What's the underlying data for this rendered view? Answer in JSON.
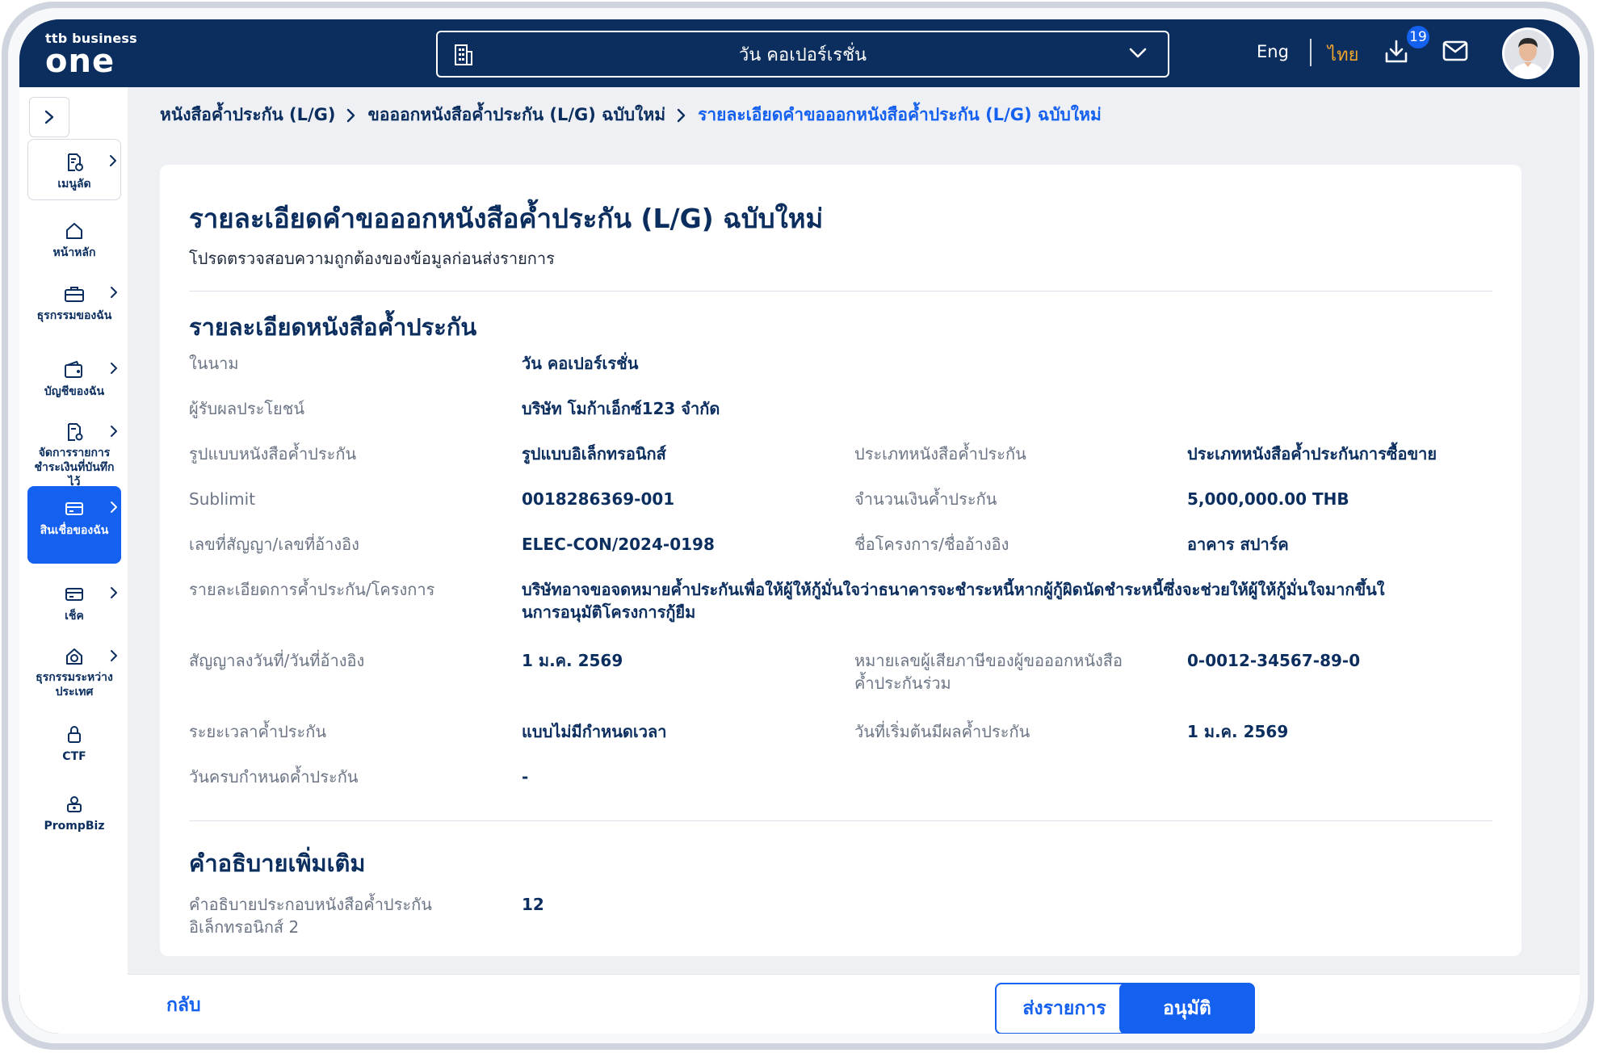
{
  "header": {
    "logo_small": "ttb business",
    "logo_big": "one",
    "company_selected": "วัน คอเปอร์เรชั่น",
    "lang_eng": "Eng",
    "lang_thai": "ไทย",
    "download_badge": "19",
    "accent_color": "#f0a52c",
    "brand_color": "#0b2e5f",
    "primary_color": "#1460ef"
  },
  "sidebar": {
    "items": [
      {
        "label": "เมนูลัด",
        "icon": "document-shortcut-icon"
      },
      {
        "label": "หน้าหลัก",
        "icon": "home-icon"
      },
      {
        "label": "ธุรกรรมของฉัน",
        "icon": "briefcase-icon"
      },
      {
        "label": "บัญชีของฉัน",
        "icon": "wallet-icon"
      },
      {
        "label": "จัดการรายการชำระเงินที่บันทึกไว้",
        "icon": "document-settings-icon"
      },
      {
        "label": "สินเชื่อของฉัน",
        "icon": "credit-card-icon"
      },
      {
        "label": "เช็ค",
        "icon": "cheque-icon"
      },
      {
        "label": "ธุรกรรมระหว่างประเทศ",
        "icon": "international-icon"
      },
      {
        "label": "CTF",
        "icon": "lock-icon"
      },
      {
        "label": "PrompBiz",
        "icon": "prompbiz-icon"
      }
    ]
  },
  "breadcrumb": {
    "item1": "หนังสือค้ำประกัน (L/G)",
    "item2": "ขอออกหนังสือค้ำประกัน (L/G) ฉบับใหม่",
    "current": "รายละเอียดคำขอออกหนังสือค้ำประกัน (L/G) ฉบับใหม่"
  },
  "page": {
    "title": "รายละเอียดคำขอออกหนังสือค้ำประกัน (L/G) ฉบับใหม่",
    "subtitle": "โปรดตรวจสอบความถูกต้องของข้อมูลก่อนส่งรายการ"
  },
  "details": {
    "section_title": "รายละเอียดหนังสือค้ำประกัน",
    "on_behalf_label": "ในนาม",
    "on_behalf_value": "วัน คอเปอร์เรชั่น",
    "beneficiary_label": "ผู้รับผลประโยชน์",
    "beneficiary_value": "บริษัท โมก้าเอ็กซ์123 จำกัด",
    "format_label": "รูปแบบหนังสือค้ำประกัน",
    "format_value": "รูปแบบอิเล็กทรอนิกส์",
    "type_label": "ประเภทหนังสือค้ำประกัน",
    "type_value": "ประเภทหนังสือค้ำประกันการซื้อขาย",
    "sublimit_label": "Sublimit",
    "sublimit_value": "0018286369-001",
    "amount_label": "จำนวนเงินค้ำประกัน",
    "amount_value": "5,000,000.00 THB",
    "contract_no_label": "เลขที่สัญญา/เลขที่อ้างอิง",
    "contract_no_value": "ELEC-CON/2024-0198",
    "project_name_label": "ชื่อโครงการ/ชื่ออ้างอิง",
    "project_name_value": "อาคาร สปาร์ค",
    "guarantee_detail_label": "รายละเอียดการค้ำประกัน/โครงการ",
    "guarantee_detail_value_line1": "บริษัทอาจขอจดหมายค้ำประกันเพื่อให้ผู้ให้กู้มั่นใจว่าธนาคารจะชำระหนี้หากผู้กู้ผิดนัดชำระหนี้ซึ่งจะช่วยให้ผู้ให้กู้มั่นใจมากขึ้นใ",
    "guarantee_detail_value_line2": "นการอนุมัติโครงการกู้ยืม",
    "contract_date_label": "สัญญาลงวันที่/วันที่อ้างอิง",
    "contract_date_value": "1 ม.ค. 2569",
    "taxid_label_line1": "หมายเลขผู้เสียภาษีของผู้ขอออกหนังสือ",
    "taxid_label_line2": "ค้ำประกันร่วม",
    "taxid_value": "0-0012-34567-89-0",
    "period_label": "ระยะเวลาค้ำประกัน",
    "period_value": "แบบไม่มีกำหนดเวลา",
    "start_date_label": "วันที่เริ่มต้นมีผลค้ำประกัน",
    "start_date_value": "1 ม.ค. 2569",
    "due_date_label": "วันครบกำหนดค้ำประกัน",
    "due_date_value": "-"
  },
  "extra": {
    "section_title": "คำอธิบายเพิ่มเติม",
    "desc_label_line1": "คำอธิบายประกอบหนังสือค้ำประกัน",
    "desc_label_line2": "อิเล็กทรอนิกส์ 2",
    "desc_value": "12"
  },
  "footer": {
    "back_label": "กลับ",
    "submit_label": "ส่งรายการ",
    "approve_label": "อนุมัติ"
  }
}
